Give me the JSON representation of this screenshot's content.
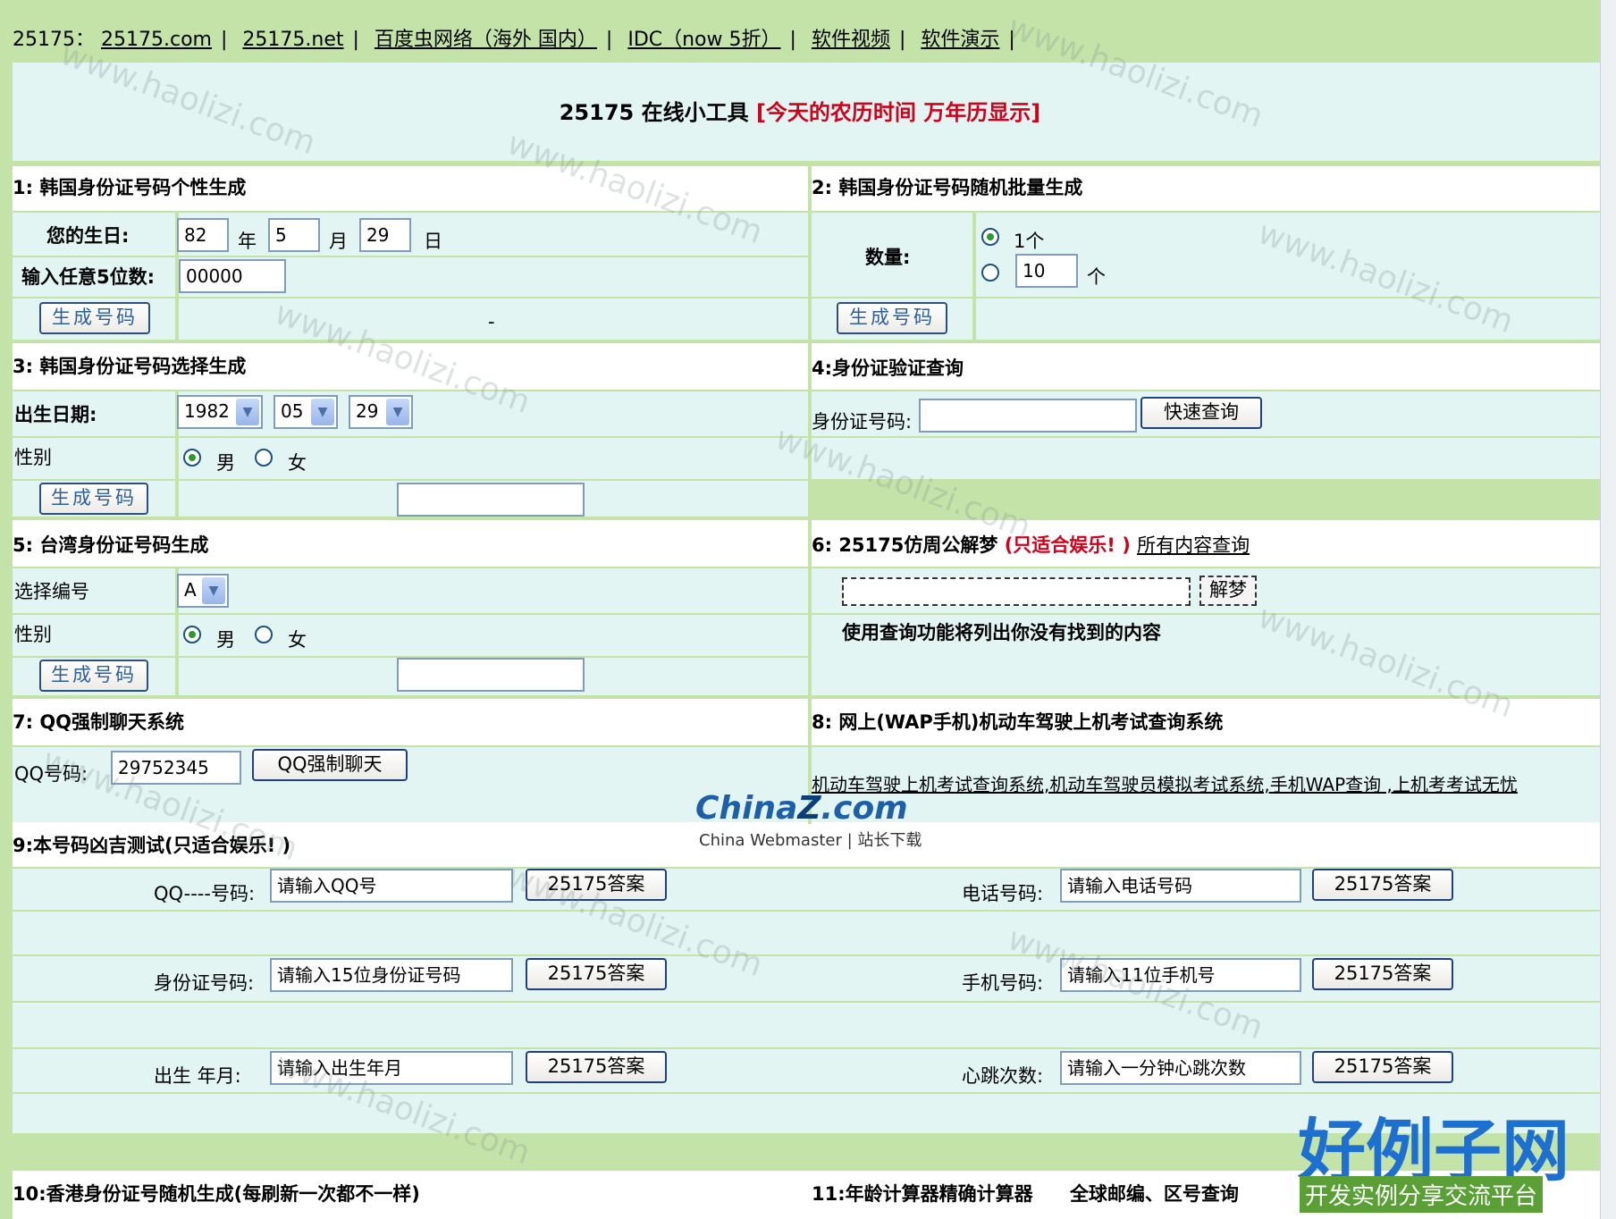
{
  "topnav": {
    "prefix": "25175：",
    "links": [
      "25175.com",
      "25175.net",
      "百度虫网络（海外  国内）",
      "IDC（now 5折）",
      "软件视频",
      "软件演示"
    ],
    "trail": "|"
  },
  "title": {
    "main": "25175 在线小工具 ",
    "red": "[今天的农历时间  万年历显示]"
  },
  "sec1": {
    "heading": "1: 韩国身份证号码个性生成",
    "birthday_label": "您的生日:",
    "year": "82",
    "year_unit": "年",
    "month": "5",
    "month_unit": "月",
    "day": "29",
    "day_unit": "日",
    "digits_label": "输入任意5位数:",
    "digits": "00000",
    "button": "生成号码",
    "dash": "-"
  },
  "sec2": {
    "heading": "2: 韩国身份证号码随机批量生成",
    "qty_label": "数量:",
    "opt1": "1个",
    "qty_value": "10",
    "qty_unit": "个",
    "button": "生成号码"
  },
  "sec3": {
    "heading": "3: 韩国身份证号码选择生成",
    "date_label": "出生日期:",
    "year": "1982",
    "month": "05",
    "day": "29",
    "gender_label": "性别",
    "male": "男",
    "female": "女",
    "button": "生成号码"
  },
  "sec4": {
    "heading": "4:身份证验证查询",
    "id_label": "身份证号码:",
    "button": "快速查询"
  },
  "sec5": {
    "heading": "5: 台湾身份证号码生成",
    "select_label": "选择编号",
    "select_value": "A",
    "gender_label": "性别",
    "male": "男",
    "female": "女",
    "button": "生成号码"
  },
  "sec6": {
    "heading": "6: 25175仿周公解梦",
    "red": "(只适合娱乐! )",
    "link": "所有内容查询",
    "button": "解梦",
    "note": "使用查询功能将列出你没有找到的内容"
  },
  "sec7": {
    "heading": "7: QQ强制聊天系统",
    "qq_label": "QQ号码:",
    "qq_value": "29752345",
    "button": "QQ强制聊天"
  },
  "sec8": {
    "heading": "8: 网上(WAP手机)机动车驾驶上机考试查询系统",
    "link": "机动车驾驶上机考试查询系统,机动车驾驶员模拟考试系统,手机WAP查询 ,上机考考试无忧"
  },
  "sec9": {
    "heading": "9:本号码凶吉测试(只适合娱乐! )",
    "rows": [
      {
        "left_label": "QQ----号码:",
        "left_placeholder": "请输入QQ号",
        "right_label": "电话号码:",
        "right_placeholder": "请输入电话号码"
      },
      {
        "left_label": "身份证号码:",
        "left_placeholder": "请输入15位身份证号码",
        "right_label": "手机号码:",
        "right_placeholder": "请输入11位手机号"
      },
      {
        "left_label": "出生  年月:",
        "left_placeholder": "请输入出生年月",
        "right_label": "心跳次数:",
        "right_placeholder": "请输入一分钟心跳次数"
      }
    ],
    "button": "25175答案"
  },
  "sec10": {
    "heading": "10:香港身份证号随机生成(每刷新一次都不一样)"
  },
  "sec11": {
    "heading": "11:年龄计算器精确计算器",
    "extra": "全球邮编、区号查询"
  },
  "logo1": {
    "china": "China",
    "z": "Z",
    "com": ".com",
    "sub": "China Webmaster | 站长下载"
  },
  "logo2": {
    "cn": "好例子网",
    "bar": "开发实例分享交流平台"
  },
  "watermark": "www.haolizi.com",
  "colors": {
    "bg_green": "#c4e3a8",
    "panel": "#e2f5f3",
    "red": "#d0021b",
    "link_blue": "#2b5fa0"
  }
}
